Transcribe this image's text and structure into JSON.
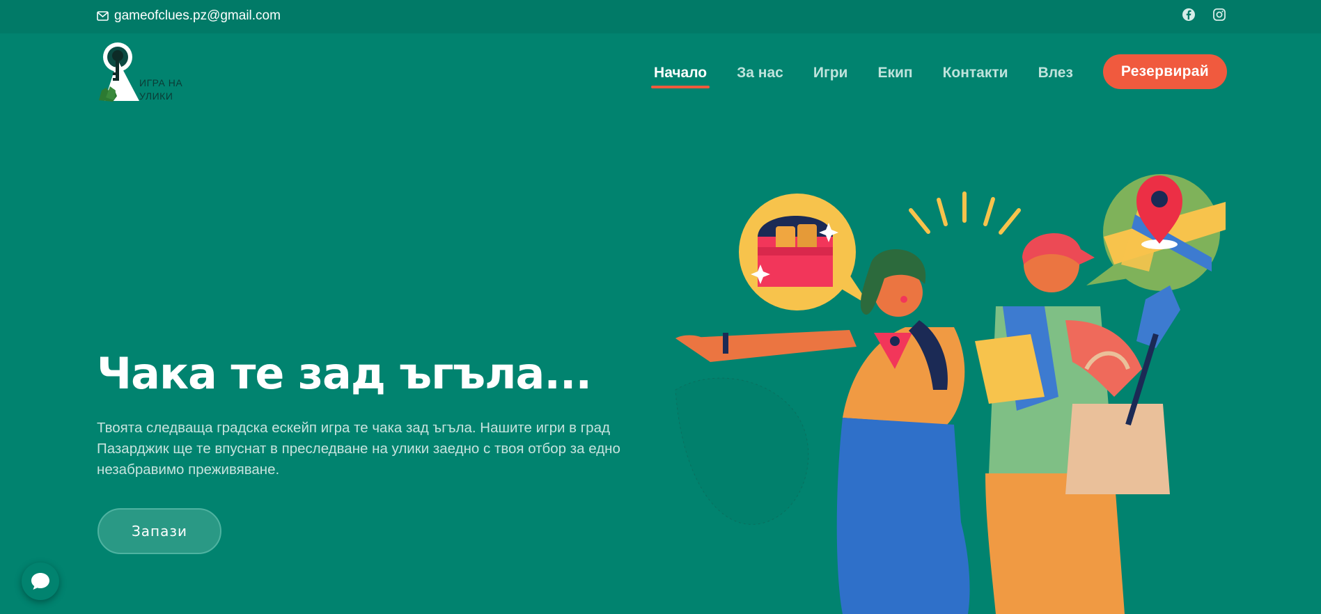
{
  "topbar": {
    "email": "gameofclues.pz@gmail.com",
    "icons": [
      "mail-icon",
      "facebook-icon",
      "instagram-icon"
    ]
  },
  "logo": {
    "line1": "ИГРА НА",
    "line2": "УЛИКИ"
  },
  "nav": {
    "items": [
      {
        "label": "Начало",
        "active": true
      },
      {
        "label": "За нас",
        "active": false
      },
      {
        "label": "Игри",
        "active": false
      },
      {
        "label": "Екип",
        "active": false
      },
      {
        "label": "Контакти",
        "active": false
      },
      {
        "label": "Влез",
        "active": false
      }
    ],
    "cta_label": "Резервирай"
  },
  "hero": {
    "title": "Чака те зад ъгъла...",
    "text": "Твоята следваща градска ескейп игра те чака зад ъгъла. Нашите игри в град Пазарджик ще те впуснат в преследване на улики заедно с твоя отбор за едно незабравимо преживяване.",
    "button_label": "Запази"
  },
  "colors": {
    "background": "#01836f",
    "topbar": "#017a67",
    "accent": "#f05a3e",
    "nav_inactive": "#bfe3dc"
  }
}
